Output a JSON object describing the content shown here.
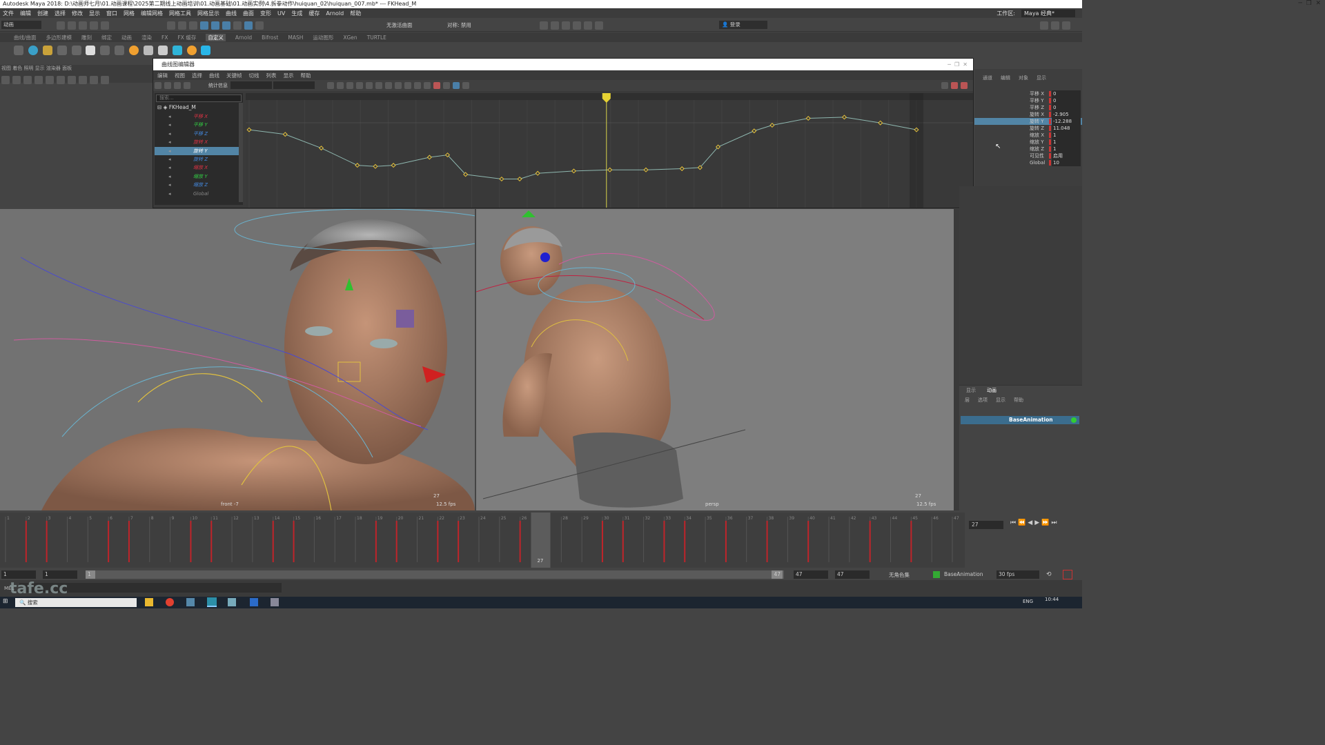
{
  "app": {
    "title": "Autodesk Maya 2018: D:\\动画师七月\\01.动画课程\\2025第二期线上动画培训\\01.动画基础\\01.动画实例\\4.拆拳动作\\huiquan_02\\huiquan_007.mb*   ---   FKHead_M",
    "workspace_label": "工作区:",
    "workspace_value": "Maya 经典*",
    "menus": [
      "文件",
      "编辑",
      "创建",
      "选择",
      "修改",
      "显示",
      "窗口",
      "网格",
      "编辑网格",
      "网格工具",
      "网格显示",
      "曲线",
      "曲面",
      "变形",
      "UV",
      "生成",
      "缓存",
      "Arnold",
      "帮助"
    ],
    "mode": "动画",
    "symmetry": "对称: 禁用",
    "no_live": "无激活曲面",
    "login": "登录"
  },
  "shelf": {
    "tabs": [
      "曲线/曲面",
      "多边形建模",
      "雕刻",
      "绑定",
      "动画",
      "渲染",
      "FX",
      "FX 缓存",
      "自定义",
      "Arnold",
      "Bifrost",
      "MASH",
      "运动图形",
      "XGen",
      "TURTLE"
    ],
    "active_tab": "自定义"
  },
  "graph_editor": {
    "title": "曲线图编辑器",
    "menus": [
      "编辑",
      "视图",
      "选择",
      "曲线",
      "关键帧",
      "切线",
      "列表",
      "显示",
      "帮助"
    ],
    "stats_label": "统计信息",
    "search_placeholder": "搜索...",
    "node": "FKHead_M",
    "channels": [
      {
        "label": "平移 X",
        "color": "#d34"
      },
      {
        "label": "平移 Y",
        "color": "#3c4"
      },
      {
        "label": "平移 Z",
        "color": "#48d"
      },
      {
        "label": "旋转 X",
        "color": "#d34"
      },
      {
        "label": "旋转 Y",
        "color": "#ddd",
        "selected": true
      },
      {
        "label": "旋转 Z",
        "color": "#48d"
      },
      {
        "label": "缩放 X",
        "color": "#d34"
      },
      {
        "label": "缩放 Y",
        "color": "#3c4"
      },
      {
        "label": "缩放 Z",
        "color": "#48d"
      },
      {
        "label": "Global",
        "color": "#888"
      }
    ],
    "current_frame_marker": "27",
    "curve_keys": [
      [
        0,
        0.32
      ],
      [
        1,
        0.36
      ],
      [
        2,
        0.48
      ],
      [
        3,
        0.63
      ],
      [
        3.5,
        0.64
      ],
      [
        4,
        0.63
      ],
      [
        5,
        0.56
      ],
      [
        5.5,
        0.54
      ],
      [
        6,
        0.71
      ],
      [
        7,
        0.75
      ],
      [
        7.5,
        0.75
      ],
      [
        8,
        0.7
      ],
      [
        9,
        0.68
      ],
      [
        10,
        0.67
      ],
      [
        11,
        0.67
      ],
      [
        12,
        0.66
      ],
      [
        12.5,
        0.65
      ],
      [
        13,
        0.47
      ],
      [
        14,
        0.33
      ],
      [
        14.5,
        0.28
      ],
      [
        15.5,
        0.22
      ],
      [
        16.5,
        0.21
      ],
      [
        17.5,
        0.26
      ],
      [
        18.5,
        0.32
      ]
    ]
  },
  "channel_box": {
    "attrs": [
      {
        "label": "平移 X",
        "value": "0"
      },
      {
        "label": "平移 Y",
        "value": "0"
      },
      {
        "label": "平移 Z",
        "value": "0"
      },
      {
        "label": "旋转 X",
        "value": "-2.905"
      },
      {
        "label": "旋转 Y",
        "value": "-12.288"
      },
      {
        "label": "旋转 Z",
        "value": "11.048"
      },
      {
        "label": "缩放 X",
        "value": "1"
      },
      {
        "label": "缩放 Y",
        "value": "1"
      },
      {
        "label": "缩放 Z",
        "value": "1"
      },
      {
        "label": "可见性",
        "value": "启用"
      },
      {
        "label": "Global",
        "value": "10"
      }
    ],
    "tabs": [
      "通道",
      "编辑",
      "对象",
      "显示"
    ]
  },
  "layer_panel": {
    "tabs": [
      "显示",
      "动画"
    ],
    "menus": [
      "层",
      "选项",
      "显示",
      "帮助"
    ],
    "layer_name": "BaseAnimation"
  },
  "viewport_left": {
    "camera": "front -7",
    "frame": "27",
    "fps": "12.5 fps"
  },
  "viewport_right": {
    "camera": "persp",
    "frame": "27",
    "fps": "12.5 fps"
  },
  "timeline": {
    "start": 1,
    "end": 47,
    "current": 27,
    "key_frames": [
      2,
      3,
      6,
      7,
      10,
      11,
      14,
      15,
      19,
      20,
      22,
      23,
      26,
      27,
      30,
      31,
      33,
      34,
      36,
      38,
      40,
      43,
      45
    ],
    "current_label": "27"
  },
  "range": {
    "start": "1",
    "start2": "1",
    "range_start_field": "1",
    "end": "47",
    "end2": "47",
    "end3": "47",
    "char_set": "无角色集",
    "anim_layer": "BaseAnimation",
    "fps": "30 fps"
  },
  "playback": {
    "current": "27"
  },
  "cmd": {
    "label": "MEL"
  },
  "taskbar": {
    "search": "搜索",
    "lang": "ENG",
    "time": "10:44"
  },
  "watermark": "tafe.cc"
}
